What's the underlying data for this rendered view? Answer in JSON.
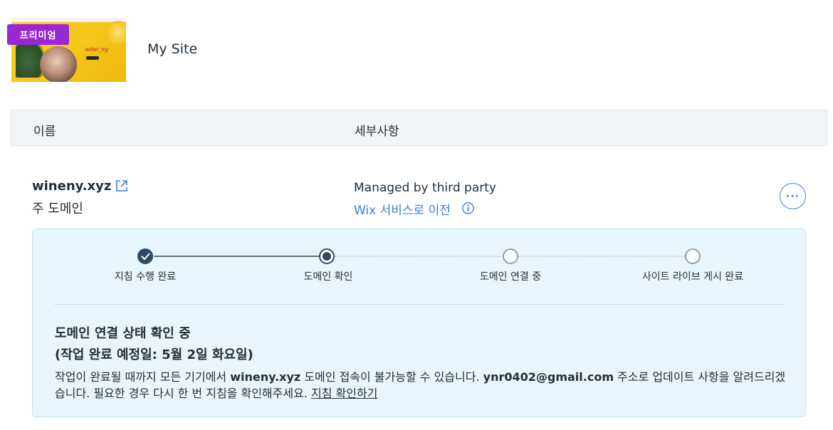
{
  "site": {
    "name": "My Site",
    "badge": "프리미엄",
    "thumbnail_brand": "wine_ny"
  },
  "table": {
    "col_name": "이름",
    "col_details": "세부사항"
  },
  "domain": {
    "name": "wineny.xyz",
    "type": "주 도메인",
    "managed": "Managed by third party",
    "transfer_link": "Wix 서비스로 이전",
    "more_label": "···"
  },
  "steps": [
    {
      "label": "지침 수행 완료",
      "state": "done"
    },
    {
      "label": "도메인 확인",
      "state": "current"
    },
    {
      "label": "도메인 연결 중",
      "state": "pending"
    },
    {
      "label": "사이트 라이브 게시 완료",
      "state": "pending"
    }
  ],
  "status": {
    "title": "도메인 연결 상태 확인 중",
    "subtitle": "(작업 완료 예정일: 5월 2일 화요일)",
    "body_1": "작업이 완료될 때까지 모든 기기에서 ",
    "body_domain": "wineny.xyz",
    "body_2": " 도메인 접속이 불가능할 수 있습니다. ",
    "body_email": "ynr0402@gmail.com",
    "body_3": " 주소로 업데이트 사항을 알려드리겠습니다. 필요한 경우 다시 한 번 지침을 확인해주세요. ",
    "guide_link": "지침 확인하기"
  },
  "colors": {
    "accent": "#3b7fd6",
    "premium": "#9a27d5",
    "panel": "#e8f5fc",
    "step_dark": "#2f4a5f",
    "step_pending": "#8aa0af"
  },
  "icons": {
    "external_link": "external-link-icon",
    "info": "info-icon",
    "check": "check-icon",
    "more": "more-icon"
  }
}
